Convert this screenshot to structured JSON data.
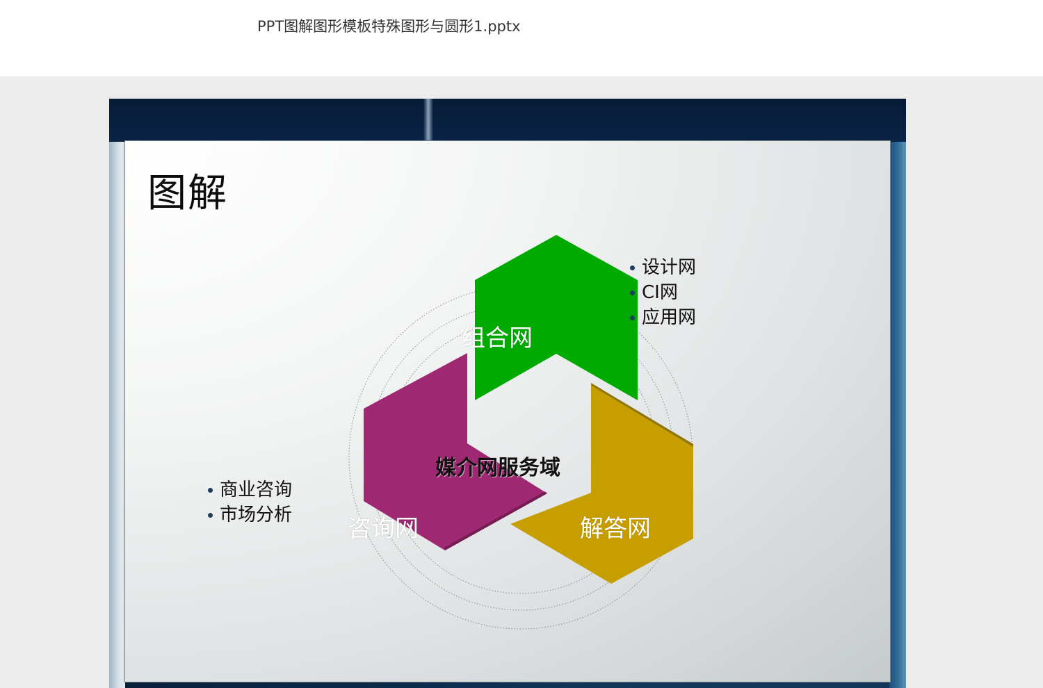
{
  "document": {
    "title": "PPT图解图形模板特殊图形与圆形1.pptx"
  },
  "slide": {
    "heading": "图解",
    "center_label": "媒介网服务域",
    "segments": [
      {
        "label": "组合网",
        "color": "#00aa00"
      },
      {
        "label": "解答网",
        "color": "#c79e00"
      },
      {
        "label": "咨询网",
        "color": "#9e2872"
      }
    ],
    "right_bullets": [
      "设计网",
      "CI网",
      "应用网"
    ],
    "left_bullets": [
      "商业咨询",
      "市场分析"
    ]
  }
}
